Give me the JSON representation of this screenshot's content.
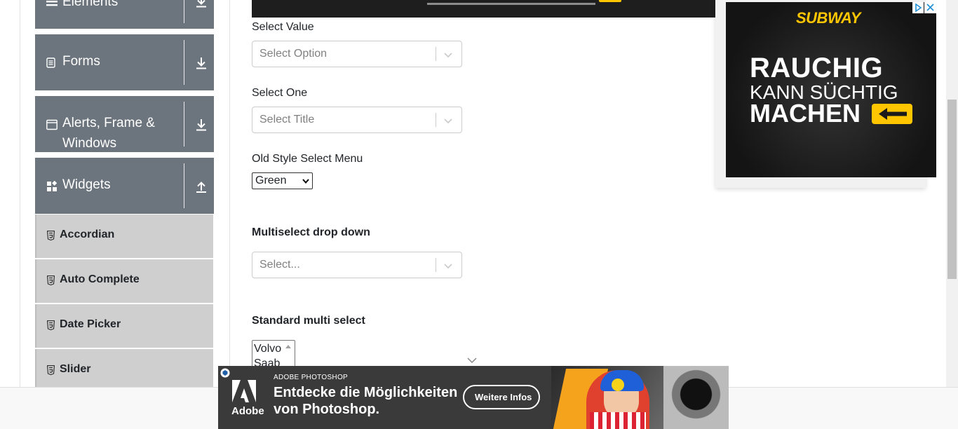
{
  "sidebar": {
    "groups": [
      {
        "label": "Elements",
        "icon": "hamburger-icon",
        "arrow": "download-arrow-icon"
      },
      {
        "label": "Forms",
        "icon": "document-icon",
        "arrow": "download-arrow-icon"
      },
      {
        "label": "Alerts, Frame &",
        "label2": "Windows",
        "icon": "window-icon",
        "arrow": "download-arrow-icon"
      },
      {
        "label": "Widgets",
        "icon": "grid-icon",
        "arrow": "upload-arrow-icon"
      }
    ],
    "items": [
      {
        "label": "Accordian",
        "icon": "html5-icon"
      },
      {
        "label": "Auto Complete",
        "icon": "html5-icon"
      },
      {
        "label": "Date Picker",
        "icon": "html5-icon"
      },
      {
        "label": "Slider",
        "icon": "html5-icon"
      }
    ]
  },
  "form": {
    "select_value_label": "Select Value",
    "select_value_placeholder": "Select Option",
    "select_one_label": "Select One",
    "select_one_placeholder": "Select Title",
    "old_style_label": "Old Style Select Menu",
    "old_style_value": "Green",
    "multiselect_label": "Multiselect drop down",
    "multiselect_placeholder": "Select...",
    "standard_multi_label": "Standard multi select",
    "standard_multi_options": [
      "Volvo",
      "Saab"
    ]
  },
  "ad_right": {
    "brand": "SUBWAY",
    "line1": "RAUCHIG",
    "line2": "KANN SÜCHTIG",
    "line3": "MACHEN"
  },
  "ad_bottom": {
    "logo_text": "Adobe",
    "eyebrow": "ADOBE PHOTOSHOP",
    "headline1": "Entdecke die Möglichkeiten",
    "headline2": "von Photoshop.",
    "cta": "Weitere Infos"
  },
  "colors": {
    "sidebar_group_bg": "#6c757d",
    "sidebar_item_bg": "#cfcfcf",
    "subway_yellow": "#ffc600"
  }
}
